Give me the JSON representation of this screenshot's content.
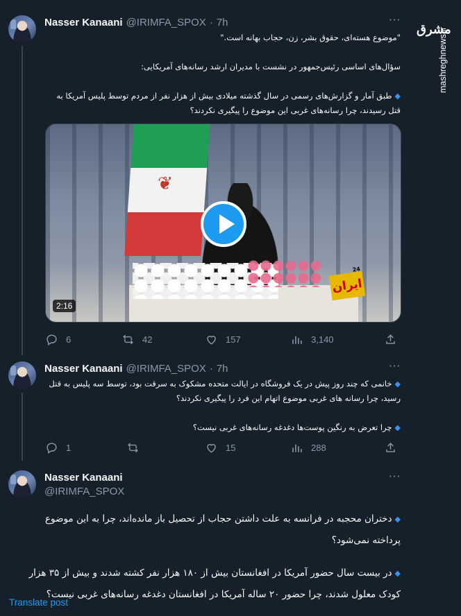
{
  "sidebar": {
    "brand_logo": "مشرق",
    "brand_url": "mashreghnews.ir"
  },
  "tweets": [
    {
      "author": "Nasser Kanaani",
      "handle": "@IRIMFA_SPOX",
      "time": "7h",
      "lines": [
        "\"موضوع هسته‌ای، حقوق بشر، زن، حجاب بهانه است.\"",
        "",
        "سؤال‌های اساسی رئیس‌جمهور در نشست با مدیران ارشد رسانه‌های آمریکایی:",
        "",
        "طبق آمار و گزارش‌های رسمی در سال گذشته میلادی بیش از هزار نفر از مردم توسط پلیس آمریکا به",
        "قتل رسیدند، چرا رسانه‌های غربی این موضوع را پیگیری نکردند؟"
      ],
      "video": {
        "duration": "2:16",
        "channel_logo": "ایران",
        "channel_tag": "24"
      },
      "stats": {
        "replies": "6",
        "reposts": "42",
        "likes": "157",
        "views": "3,140"
      }
    },
    {
      "author": "Nasser Kanaani",
      "handle": "@IRIMFA_SPOX",
      "time": "7h",
      "lines": [
        "خانمی که چند روز پیش در یک فروشگاه در ایالت متحده مشکوک به سرقت بود، توسط سه پلیس به قتل",
        "رسید، چرا رسانه های غربی موضوع اتهام این فرد را پیگیری نکردند؟",
        "",
        "چرا تعرض به رنگین پوست‌ها دغدغه رسانه‌های غربی نیست؟"
      ],
      "stats": {
        "replies": "1",
        "reposts": "",
        "likes": "15",
        "views": "288"
      }
    },
    {
      "author": "Nasser Kanaani",
      "handle": "@IRIMFA_SPOX",
      "lines": [
        "دختران محجبه در فرانسه به علت داشتن حجاب از تحصیل باز مانده‌اند، چرا به این موضوع",
        "پرداخته نمی‌شود؟",
        "",
        "در بیست سال حضور آمریکا در افغانستان بیش از ۱۸۰ هزار نفر کشته شدند و بیش از ۳۵ هزار",
        "کودک معلول شدند، چرا حضور ۲۰ ساله آمریکا در افغانستان دغدغه رسانه‌های غربی نیست؟"
      ],
      "translate": "Translate post"
    }
  ],
  "colors": {
    "background": "#15202b",
    "accent": "#1d9bf0",
    "muted": "#8b98a5",
    "diamond": "#3d8ff5"
  }
}
